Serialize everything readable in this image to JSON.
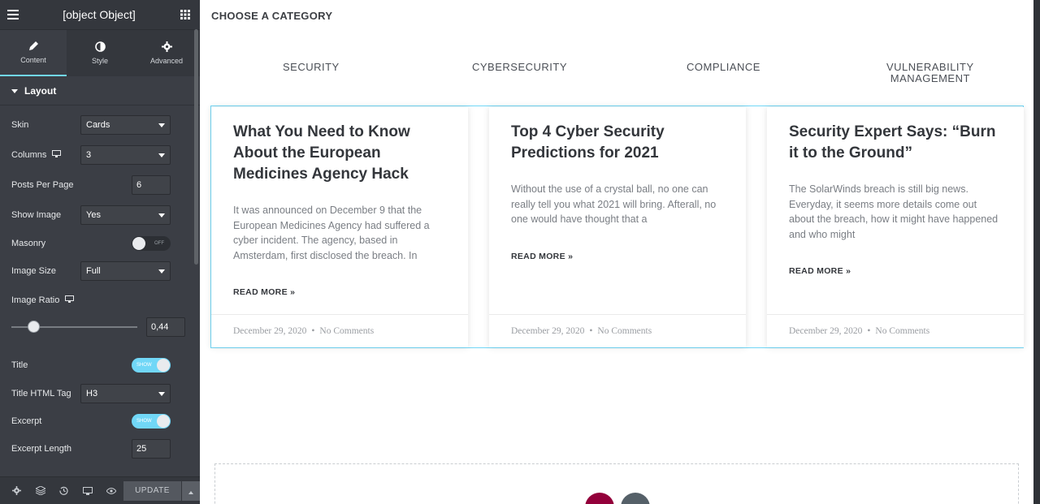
{
  "panel": {
    "title": {
      "label": "Title",
      "state": "SHOW"
    },
    "tabs": [
      {
        "label": "Content",
        "icon": "pencil-icon",
        "active": true
      },
      {
        "label": "Style",
        "icon": "half-circle-icon",
        "active": false
      },
      {
        "label": "Advanced",
        "icon": "gear-icon",
        "active": false
      }
    ],
    "section": "Layout",
    "skin": {
      "label": "Skin",
      "value": "Cards"
    },
    "columns": {
      "label": "Columns",
      "value": "3"
    },
    "posts_per_page": {
      "label": "Posts Per Page",
      "value": "6"
    },
    "show_image": {
      "label": "Show Image",
      "value": "Yes"
    },
    "masonry": {
      "label": "Masonry",
      "state": "OFF"
    },
    "image_size": {
      "label": "Image Size",
      "value": "Full"
    },
    "image_ratio": {
      "label": "Image Ratio",
      "value": "0,44"
    },
    "title_tag": {
      "label": "Title HTML Tag",
      "value": "H3"
    },
    "excerpt": {
      "label": "Excerpt",
      "state": "SHOW"
    },
    "excerpt_length": {
      "label": "Excerpt Length",
      "value": "25"
    },
    "update_label": "UPDATE"
  },
  "canvas": {
    "heading": "CHOOSE A CATEGORY",
    "categories": [
      "SECURITY",
      "CYBERSECURITY",
      "COMPLIANCE",
      "VULNERABILITY\nMANAGEMENT"
    ],
    "posts": [
      {
        "title": "What You Need to Know About the European Medicines Agency Hack",
        "excerpt": "It was announced on December 9 that the European Medicines Agency had suffered a cyber incident. The agency, based in Amsterdam, first disclosed the breach. In",
        "read_more": "READ MORE »",
        "date": "December 29, 2020",
        "separator": "•",
        "comments": "No Comments"
      },
      {
        "title": "Top 4 Cyber Security Predictions for 2021",
        "excerpt": "Without the use of a crystal ball, no one can really tell you what 2021 will bring. Afterall, no one would have thought that a",
        "read_more": "READ MORE »",
        "date": "December 29, 2020",
        "separator": "•",
        "comments": "No Comments"
      },
      {
        "title": "Security Expert Says: “Burn it to the Ground”",
        "excerpt": "The SolarWinds breach is still big news. Everyday, it seems more details come out about the breach, how it might have happened and who might",
        "read_more": "READ MORE »",
        "date": "December 29, 2020",
        "separator": "•",
        "comments": "No Comments"
      }
    ]
  },
  "colors": {
    "panel_bg": "#3b3e45",
    "accent": "#71d7f7",
    "card_border": "#71d7f7",
    "add_button": "#93003a",
    "secondary_button": "#556068"
  }
}
